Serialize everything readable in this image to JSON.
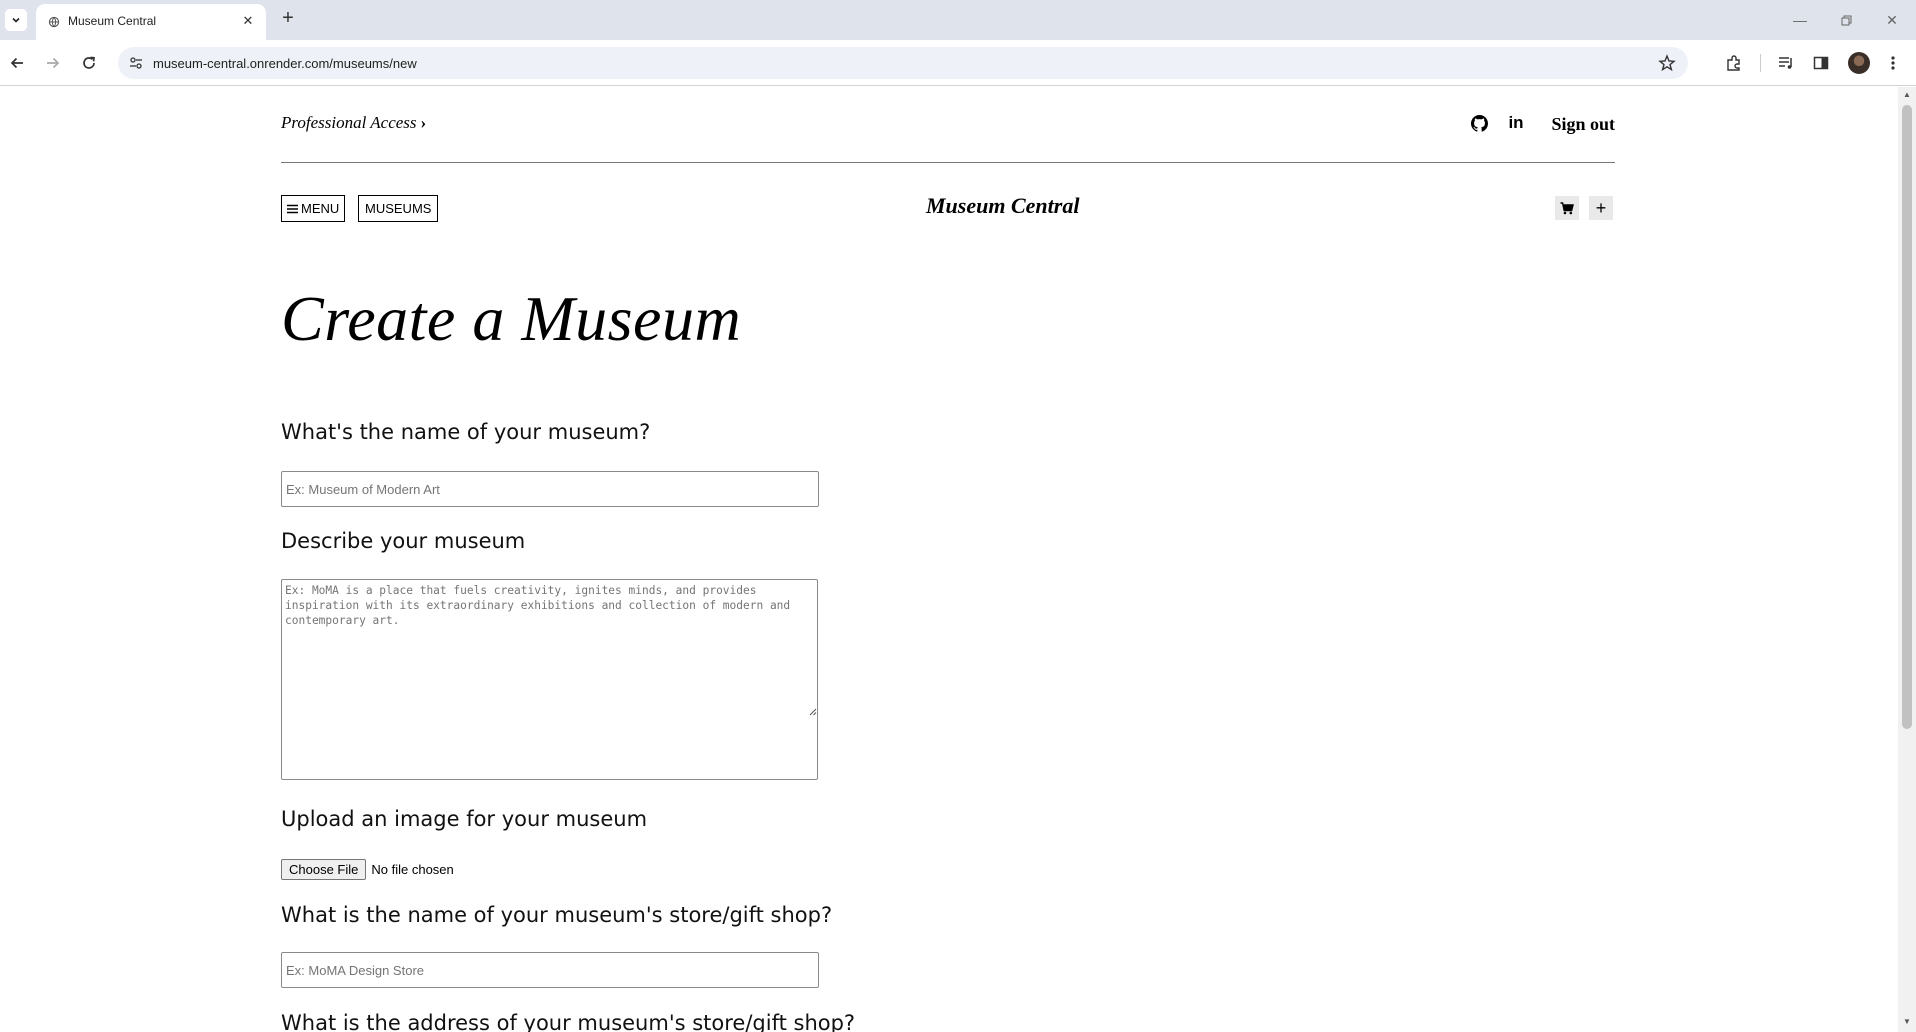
{
  "browser": {
    "tab": {
      "title": "Museum Central"
    },
    "url": "museum-central.onrender.com/museums/new"
  },
  "header": {
    "professional_link": "Professional Access",
    "sign_out": "Sign out",
    "linkedin_label": "in",
    "menu_label": "MENU",
    "museums_label": "MUSEUMS",
    "brand": "Museum Central"
  },
  "form": {
    "title": "Create a Museum",
    "name_question": "What's the name of your museum?",
    "name_placeholder": "Ex: Museum of Modern Art",
    "describe_question": "Describe your museum",
    "describe_placeholder": "Ex: MoMA is a place that fuels creativity, ignites minds, and provides inspiration with its extraordinary exhibitions and collection of modern and contemporary art.",
    "image_question": "Upload an image for your museum",
    "choose_file_label": "Choose File",
    "file_status": "No file chosen",
    "store_name_question": "What is the name of your museum's store/gift shop?",
    "store_name_placeholder": "Ex: MoMA Design Store",
    "store_address_question": "What is the address of your museum's store/gift shop?"
  },
  "icons": {
    "tab_favicon": "globe-icon",
    "github": "github-icon",
    "cart": "cart-icon",
    "add": "plus-icon",
    "hamburger": "hamburger-icon"
  }
}
